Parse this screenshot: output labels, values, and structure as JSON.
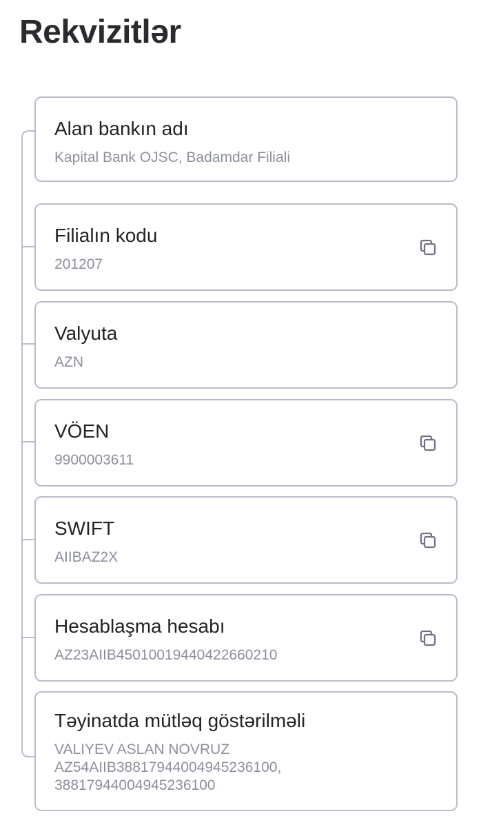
{
  "page": {
    "title": "Rekvizitlər"
  },
  "requisites": [
    {
      "label": "Alan bankın adı",
      "value": "Kapital Bank OJSC, Badamdar Filiali",
      "copyable": false
    },
    {
      "label": "Filialın kodu",
      "value": "201207",
      "copyable": true
    },
    {
      "label": "Valyuta",
      "value": "AZN",
      "copyable": false
    },
    {
      "label": "VÖEN",
      "value": "9900003611",
      "copyable": true
    },
    {
      "label": "SWIFT",
      "value": "AIIBAZ2X",
      "copyable": true
    },
    {
      "label": "Hesablaşma hesabı",
      "value": "AZ23AIIB45010019440422660210",
      "copyable": true
    },
    {
      "label": "Təyinatda mütləq göstərilməli",
      "value": "VALIYEV ASLAN NOVRUZ\n AZ54AIIB38817944004945236100,\n38817944004945236100",
      "copyable": false
    }
  ],
  "icons": {
    "copy": "copy-icon"
  },
  "colors": {
    "card_border": "#b9bccb",
    "label_text": "#232328",
    "value_text": "#8c8f9c",
    "tree_line": "#b9bccb"
  }
}
